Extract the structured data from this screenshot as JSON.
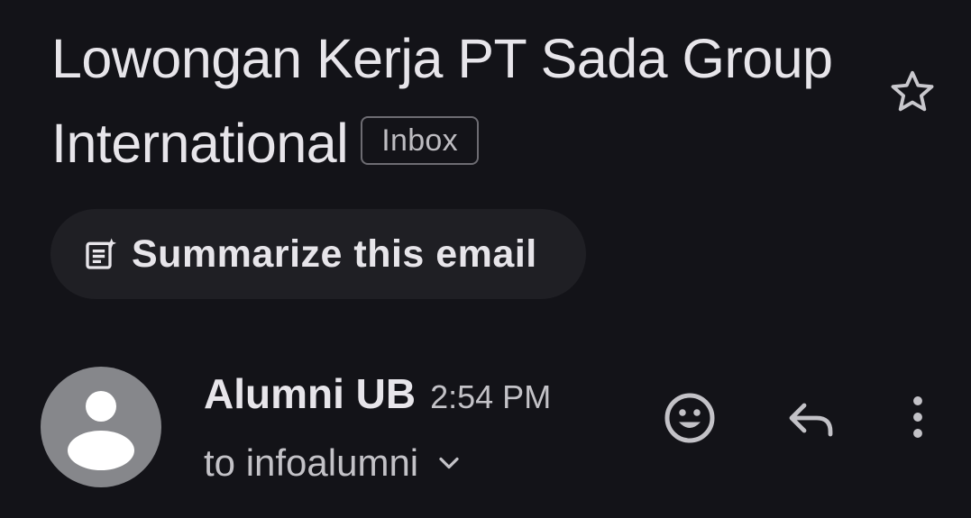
{
  "email": {
    "subject": "Lowongan Kerja PT Sada Group International",
    "label": "Inbox"
  },
  "actions": {
    "summarize_label": "Summarize this email"
  },
  "sender": {
    "name": "Alumni UB",
    "time": "2:54 PM",
    "recipient_text": "to infoalumni"
  },
  "icons": {
    "star": "star-outline-icon",
    "summarize": "summarize-sparkle-icon",
    "avatar": "person-avatar-icon",
    "emoji": "add-reaction-smiley-icon",
    "reply": "reply-arrow-icon",
    "more": "more-vertical-icon",
    "expand": "chevron-down-icon"
  },
  "colors": {
    "background": "#131318",
    "chip_background": "#1f1f24",
    "avatar": "#86878b",
    "text": "#e7e5ea",
    "secondary_text": "#c3c2c7"
  }
}
